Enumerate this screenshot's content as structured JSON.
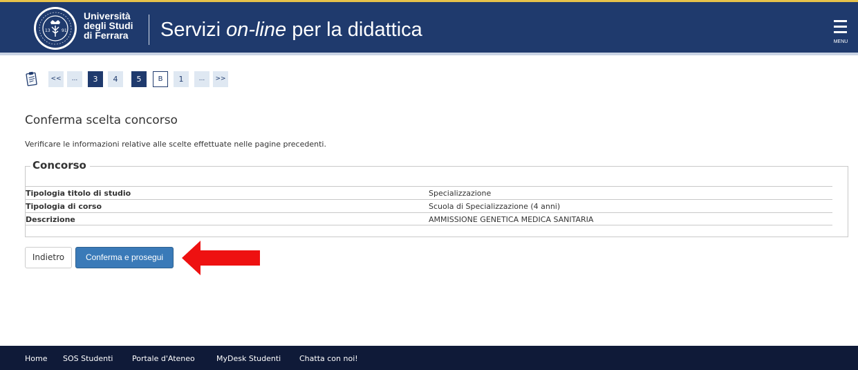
{
  "header": {
    "university_name": [
      "Università",
      "degli Studi",
      "di Ferrara"
    ],
    "site_title_prefix": "Servizi ",
    "site_title_italic": "on-line",
    "site_title_suffix": " per la didattica",
    "menu_label": "MENU",
    "logo_icon": "university-seal-icon",
    "colors": {
      "header_bg": "#1f3a6d",
      "accent": "#e7c24a"
    }
  },
  "wizard": {
    "icon": "clipboard-icon",
    "steps": [
      {
        "label": "<<",
        "state": "nav"
      },
      {
        "label": "...",
        "state": "nav"
      },
      {
        "label": "3",
        "state": "active"
      },
      {
        "label": "4",
        "state": "normal"
      },
      {
        "label": "5",
        "state": "active"
      },
      {
        "label": "B",
        "state": "current"
      },
      {
        "label": "1",
        "state": "normal"
      },
      {
        "label": "...",
        "state": "nav"
      },
      {
        "label": ">>",
        "state": "nav"
      }
    ]
  },
  "main": {
    "title": "Conferma scelta concorso",
    "intro": "Verificare le informazioni relative alle scelte effettuate nelle pagine precedenti.",
    "fieldset_legend": "Concorso",
    "rows": [
      {
        "label": "Tipologia titolo di studio",
        "value": "Specializzazione"
      },
      {
        "label": "Tipologia di corso",
        "value": "Scuola di Specializzazione (4 anni)"
      },
      {
        "label": "Descrizione",
        "value": "AMMISSIONE GENETICA MEDICA SANITARIA"
      }
    ]
  },
  "actions": {
    "back_label": "Indietro",
    "confirm_label": "Conferma e prosegui",
    "annotation_icon": "red-arrow-left-icon",
    "colors": {
      "confirm_bg": "#3a7ab8",
      "arrow": "#ee1111"
    }
  },
  "footer": {
    "links": [
      "Home",
      "SOS Studenti",
      "Portale d'Ateneo",
      "MyDesk Studenti",
      "Chatta con noi!"
    ],
    "colors": {
      "footer_bg": "#0f1a38"
    }
  }
}
